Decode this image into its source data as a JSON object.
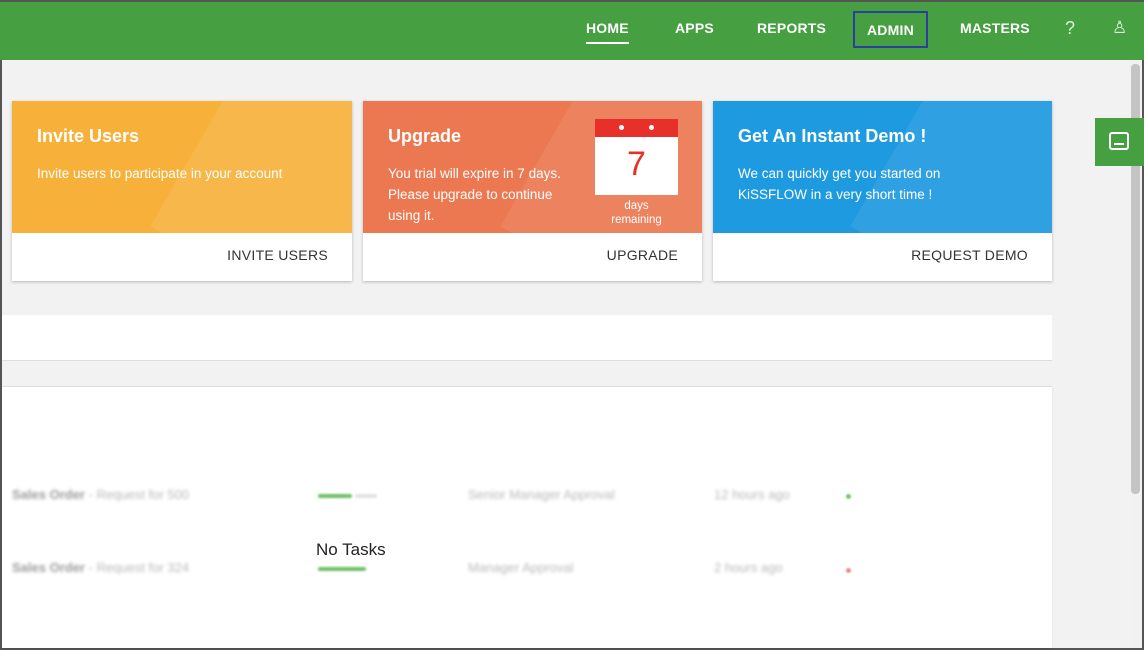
{
  "nav": {
    "items": [
      {
        "label": "HOME"
      },
      {
        "label": "APPS"
      },
      {
        "label": "REPORTS"
      },
      {
        "label": "ADMIN"
      },
      {
        "label": "MASTERS"
      }
    ],
    "help_glyph": "?",
    "user_glyph": "♙"
  },
  "cards": {
    "invite": {
      "title": "Invite Users",
      "description": "Invite users to participate in your account",
      "action": "INVITE USERS"
    },
    "upgrade": {
      "title": "Upgrade",
      "description": "You trial will expire in 7 days. Please upgrade to continue using it.",
      "action": "UPGRADE",
      "calendar_number": "7",
      "calendar_line1": "days",
      "calendar_line2": "remaining"
    },
    "demo": {
      "title": "Get An Instant Demo !",
      "description": "We can quickly get you started on KiSSFLOW in a very short time !",
      "action": "REQUEST DEMO"
    }
  },
  "tasks": {
    "empty_message": "No Tasks",
    "ghost_rows": [
      {
        "name": "Sales Order",
        "sub": "- Request for 500",
        "step": "Senior Manager Approval",
        "time": "12 hours ago"
      },
      {
        "name": "Sales Order",
        "sub": "- Request for 324",
        "step": "Manager Approval",
        "time": "2 hours ago"
      }
    ]
  },
  "colors": {
    "brand_green": "#46a042",
    "invite_orange": "#f7b13b",
    "upgrade_coral": "#ec7851",
    "demo_blue": "#1e9ae0",
    "calendar_red": "#e8302a",
    "active_box_blue": "#2b3f9e"
  }
}
